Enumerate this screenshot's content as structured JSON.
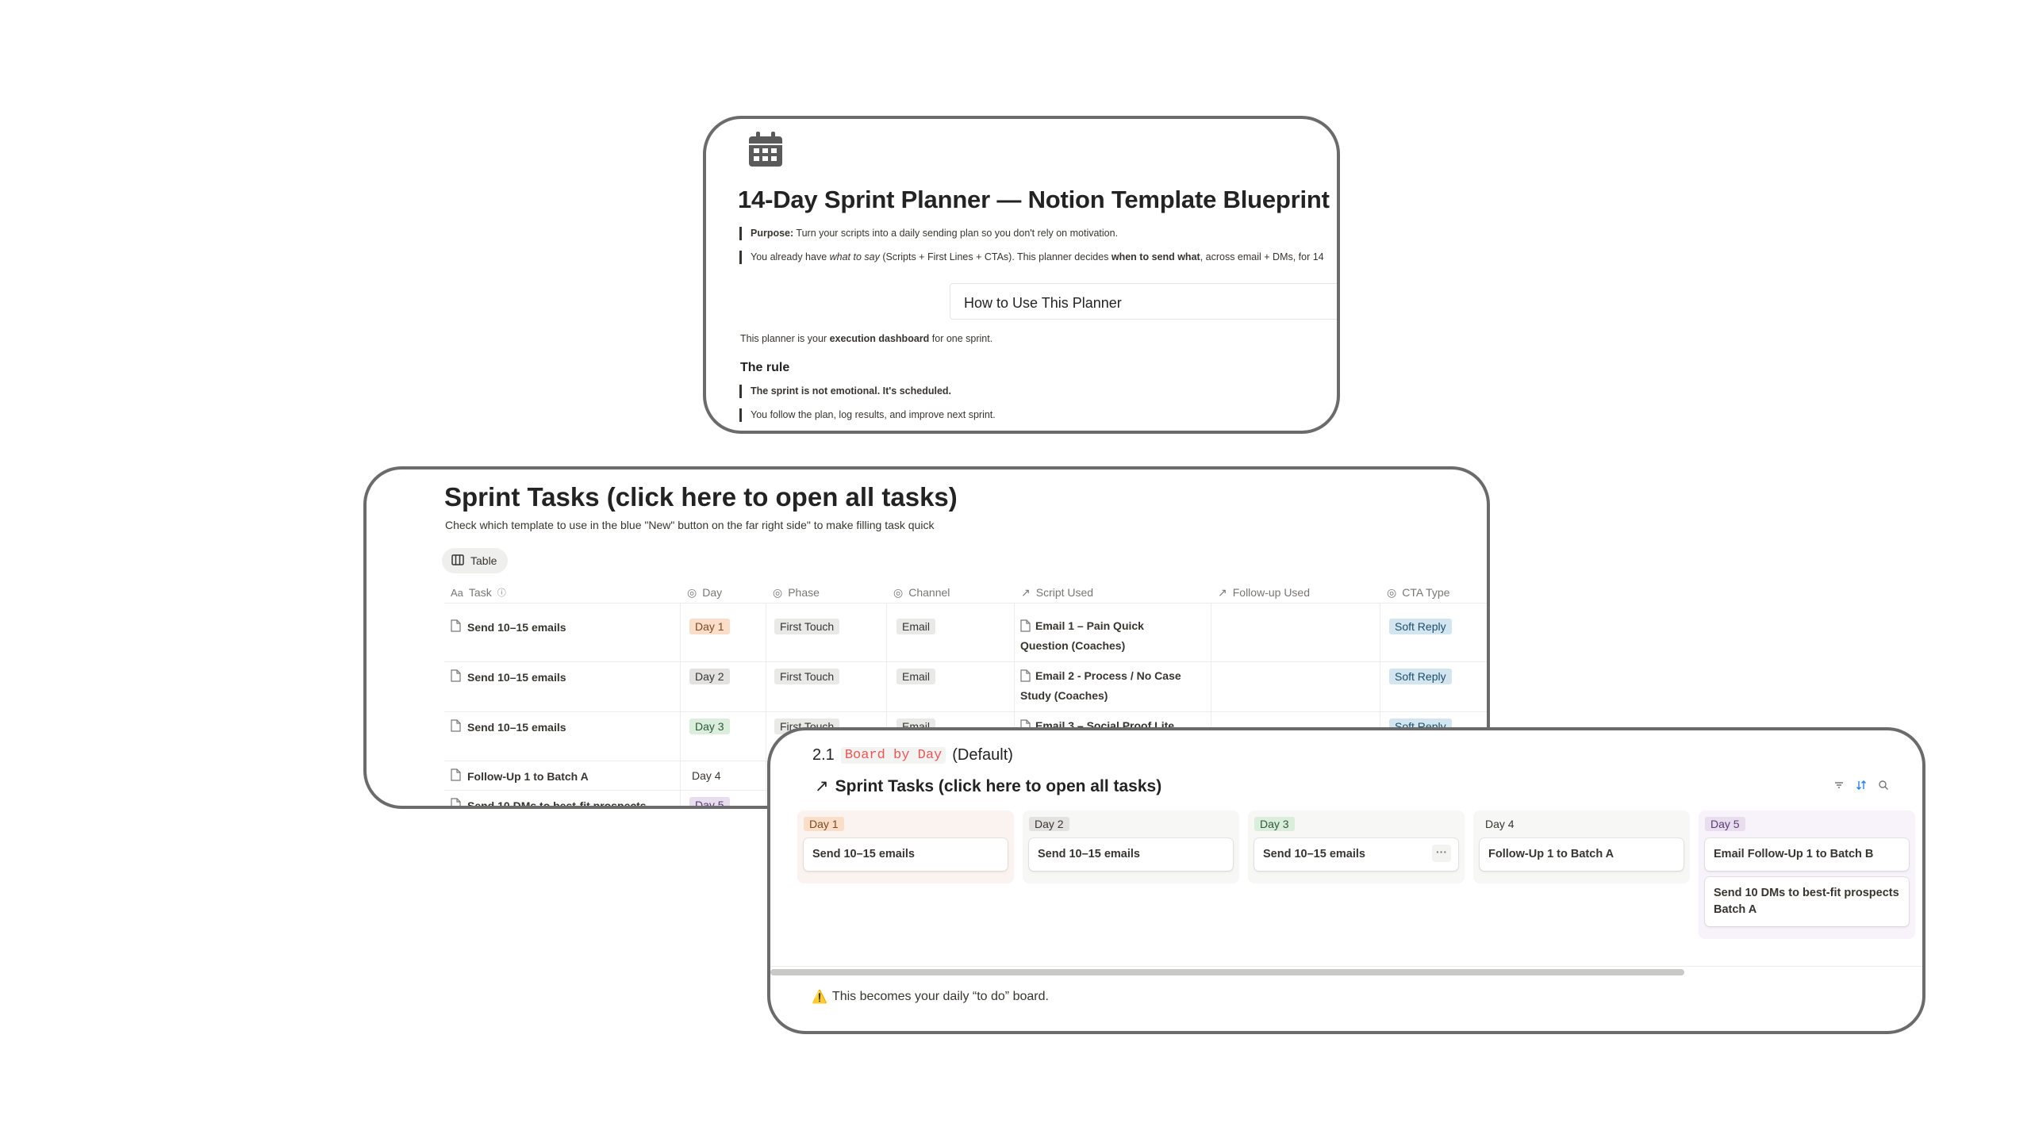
{
  "planner": {
    "title": "14-Day Sprint Planner — Notion Template Blueprint",
    "purpose_label": "Purpose:",
    "purpose_text": " Turn your scripts into a daily sending plan so you don't rely on motivation.",
    "line2_a": "You already have ",
    "line2_em": "what to say",
    "line2_b": " (Scripts + First Lines + CTAs). This planner decides ",
    "line2_strong": "when to send what",
    "line2_c": ", across email + DMs, for 14",
    "how_to_use": "How to Use This Planner",
    "dashboard_a": "This planner is your ",
    "dashboard_strong": "execution dashboard",
    "dashboard_b": " for one sprint.",
    "rule_heading": "The rule",
    "rule_quote": "The sprint is not emotional. It's scheduled.",
    "rule_follow": "You follow the plan, log results, and improve next sprint."
  },
  "tasks": {
    "title": "Sprint Tasks (click here to open all tasks)",
    "description": "Check which template to use in the blue \"New\" button on the far right side\" to make filling task quick",
    "view_tab": "Table",
    "columns": {
      "task": "Task",
      "day": "Day",
      "phase": "Phase",
      "channel": "Channel",
      "script": "Script Used",
      "followup": "Follow-up Used",
      "cta": "CTA Type"
    },
    "rows": [
      {
        "task": "Send 10–15 emails",
        "day": "Day 1",
        "phase": "First Touch",
        "channel": "Email",
        "script_1": "Email 1 – Pain Quick",
        "script_2": "Question (Coaches)",
        "cta": "Soft Reply"
      },
      {
        "task": "Send 10–15 emails",
        "day": "Day 2",
        "phase": "First Touch",
        "channel": "Email",
        "script_1": "Email 2 - Process / No Case",
        "script_2": "Study (Coaches)",
        "cta": "Soft Reply"
      },
      {
        "task": "Send 10–15 emails",
        "day": "Day 3",
        "phase": "First Touch",
        "channel": "Email",
        "script_1": "Email 3 – Social Proof Lite",
        "script_2": "",
        "cta": "Soft Reply"
      },
      {
        "task": "Follow-Up 1 to Batch A",
        "day": "Day 4"
      },
      {
        "task": "Send 10 DMs to best-fit prospects",
        "day": "Day 5"
      }
    ]
  },
  "board": {
    "number": "2.1",
    "view_name": "Board by Day",
    "default_label": "(Default)",
    "link_title": "Sprint Tasks (click here to open all tasks)",
    "columns": [
      {
        "label": "Day 1",
        "cards": [
          "Send 10–15 emails"
        ]
      },
      {
        "label": "Day 2",
        "cards": [
          "Send 10–15 emails"
        ]
      },
      {
        "label": "Day 3",
        "cards": [
          "Send 10–15 emails"
        ]
      },
      {
        "label": "Day 4",
        "cards": [
          "Follow-Up 1 to Batch A"
        ]
      },
      {
        "label": "Day 5",
        "cards": [
          "Email Follow-Up 1 to Batch B",
          "Send 10 DMs to best-fit prospects Batch A"
        ]
      }
    ],
    "more_label": "···",
    "warning_icon": "⚠️",
    "warning_text": "This becomes your daily “to do” board."
  },
  "colors": {
    "day1_bg": "#fadec9",
    "day3_bg": "#dbeddb",
    "day5_bg": "#e8deee",
    "soft_reply_bg": "#d3e5ef",
    "code_red": "#eb5757",
    "card_border": "#6b6b6b"
  },
  "icons": [
    "calendar-icon",
    "page-icon",
    "table-view-icon",
    "status-icon",
    "relation-arrow-icon",
    "filter-icon",
    "sort-icon",
    "search-icon",
    "warning-icon"
  ]
}
